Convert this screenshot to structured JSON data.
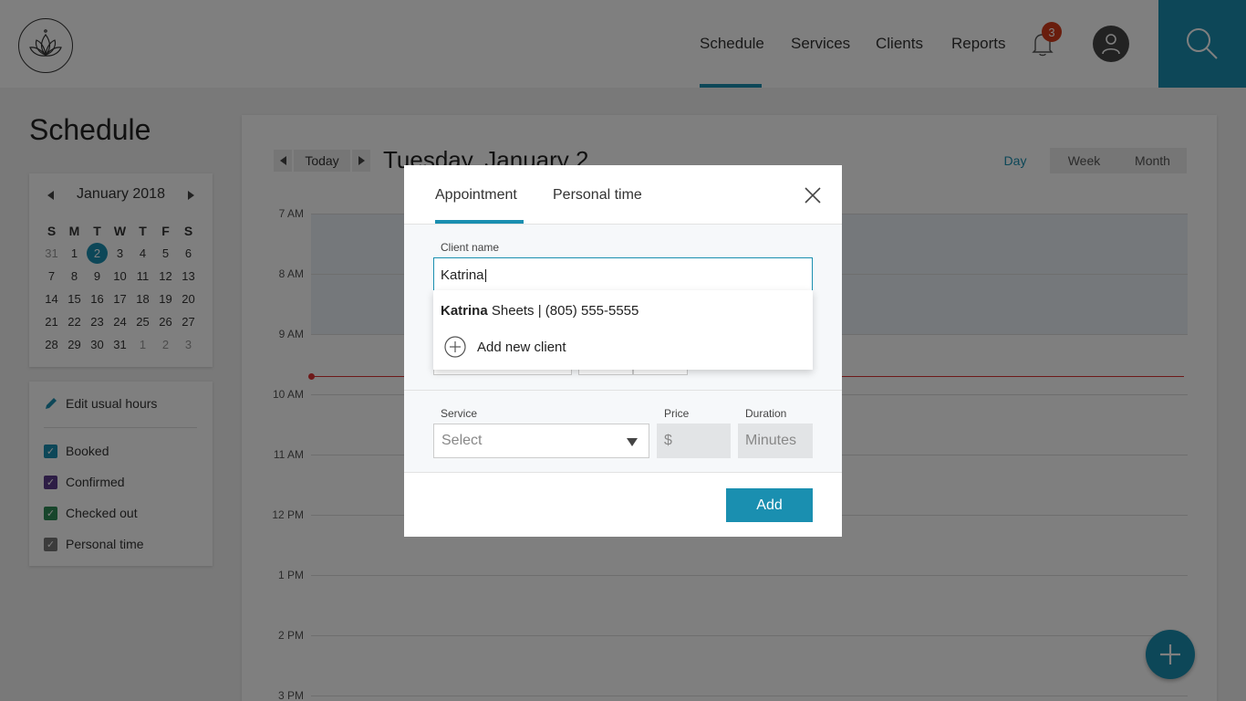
{
  "nav": {
    "items": [
      "Schedule",
      "Services",
      "Clients",
      "Reports"
    ],
    "notification_count": "3",
    "accent_color": "#1a8fb0"
  },
  "sidebar": {
    "title": "Schedule",
    "mini_calendar": {
      "month_label": "January 2018",
      "weekdays": [
        "S",
        "M",
        "T",
        "W",
        "T",
        "F",
        "S"
      ],
      "weeks": [
        [
          "31",
          "1",
          "2",
          "3",
          "4",
          "5",
          "6"
        ],
        [
          "7",
          "8",
          "9",
          "10",
          "11",
          "12",
          "13"
        ],
        [
          "14",
          "15",
          "16",
          "17",
          "18",
          "19",
          "20"
        ],
        [
          "21",
          "22",
          "23",
          "24",
          "25",
          "26",
          "27"
        ],
        [
          "28",
          "29",
          "30",
          "31",
          "1",
          "2",
          "3"
        ]
      ],
      "selected_day": "2"
    },
    "edit_hours_label": "Edit usual hours",
    "filters": [
      {
        "label": "Booked",
        "color": "#1a8fb0"
      },
      {
        "label": "Confirmed",
        "color": "#5a3a8a"
      },
      {
        "label": "Checked out",
        "color": "#2e8b57"
      },
      {
        "label": "Personal time",
        "color": "#777777"
      }
    ]
  },
  "calendar": {
    "today_label": "Today",
    "date_title": "Tuesday, January 2",
    "views": [
      "Day",
      "Week",
      "Month"
    ],
    "active_view": "Day",
    "hours": [
      "7 AM",
      "8 AM",
      "9 AM",
      "10 AM",
      "11 AM",
      "12 PM",
      "1 PM",
      "2 PM",
      "3 PM"
    ]
  },
  "modal": {
    "tabs": [
      "Appointment",
      "Personal time"
    ],
    "active_tab": "Appointment",
    "client_label": "Client name",
    "client_value": "Katrina|",
    "suggestion_match": "Katrina",
    "suggestion_rest": " Sheets | (805) 555-5555",
    "add_new_client": "Add new client",
    "service_label": "Service",
    "service_placeholder": "Select",
    "price_label": "Price",
    "price_placeholder": "$",
    "duration_label": "Duration",
    "duration_placeholder": "Minutes",
    "add_button": "Add"
  }
}
